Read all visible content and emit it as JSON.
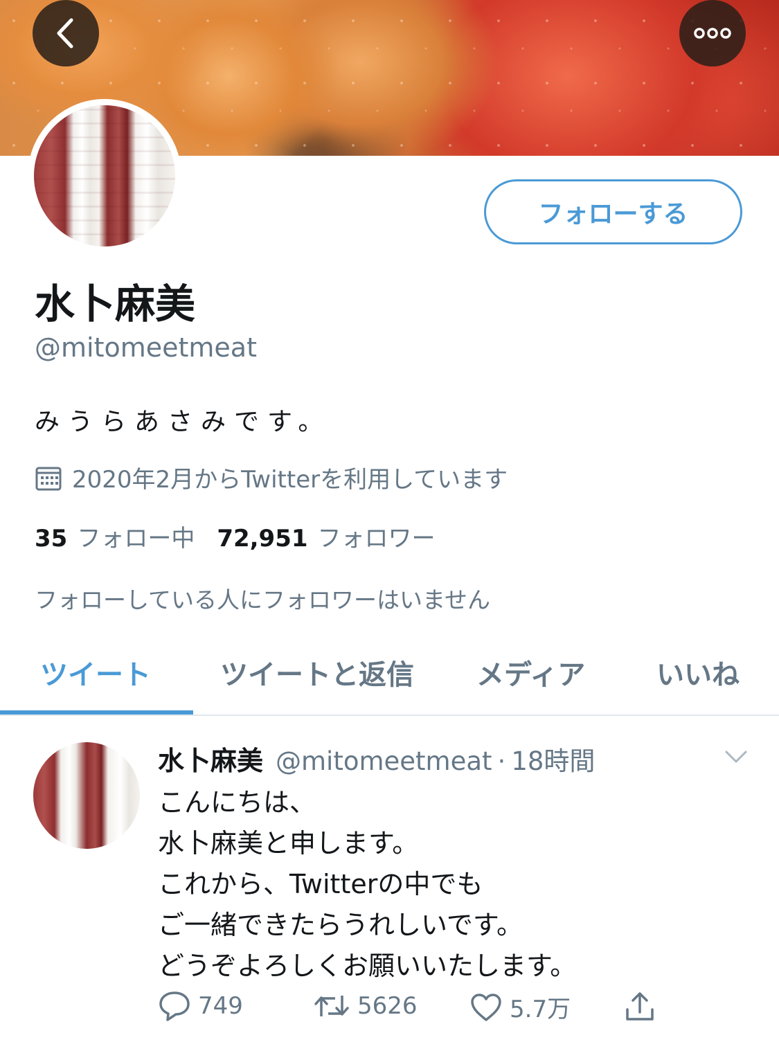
{
  "header": {
    "back_icon": "chevron-left-icon",
    "more_icon": "more-dots-icon"
  },
  "profile": {
    "display_name": "水卜麻美",
    "handle": "@mitomeetmeat",
    "bio": "みうらあさみです。",
    "joined": "2020年2月からTwitterを利用しています",
    "follow_label": "フォローする",
    "following_count": "35",
    "following_label": "フォロー中",
    "followers_count": "72,951",
    "followers_label": "フォロワー",
    "mutual_text": "フォローしている人にフォロワーはいません"
  },
  "tabs": [
    {
      "label": "ツイート",
      "active": true
    },
    {
      "label": "ツイートと返信",
      "active": false
    },
    {
      "label": "メディア",
      "active": false
    },
    {
      "label": "いいね",
      "active": false
    }
  ],
  "tweet": {
    "name": "水卜麻美",
    "handle": "@mitomeetmeat",
    "separator": "·",
    "time": "18時間",
    "lines": [
      "こんにちは、",
      "水卜麻美と申します。",
      "これから、Twitterの中でも",
      "ご一緒できたらうれしいです。",
      "どうぞよろしくお願いいたします。"
    ],
    "replies": "749",
    "retweets": "5626",
    "likes": "5.7万"
  },
  "colors": {
    "accent": "#4a9ad6",
    "secondary_text": "#657786",
    "primary_text": "#14171a",
    "divider": "#e1e8ed"
  }
}
